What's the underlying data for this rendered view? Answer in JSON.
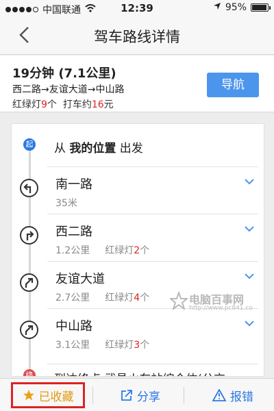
{
  "status": {
    "carrier": "中国联通",
    "time": "12:39",
    "battery": "95%",
    "battery_level": 0.95
  },
  "nav": {
    "title": "驾车路线详情"
  },
  "summary": {
    "duration_distance": "19分钟 (7.1公里)",
    "roads": "西二路→友谊大道→中山路",
    "lights_prefix": "红绿灯",
    "lights_count": "9",
    "lights_suffix": "个  打车约",
    "fare": "16",
    "fare_unit": "元",
    "navigate_label": "导航"
  },
  "route": {
    "start_badge": "起",
    "start_prefix": "从 ",
    "start_place": "我的位置",
    "start_suffix": " 出发",
    "steps": [
      {
        "name": "南一路",
        "distance": "35米",
        "lights_label": "",
        "lights_count": "",
        "lights_unit": "",
        "icon": "turn-left-icon"
      },
      {
        "name": "西二路",
        "distance": "1.2公里",
        "lights_label": "红绿灯",
        "lights_count": "2",
        "lights_unit": "个",
        "icon": "turn-right-icon"
      },
      {
        "name": "友谊大道",
        "distance": "2.7公里",
        "lights_label": "红绿灯",
        "lights_count": "4",
        "lights_unit": "个",
        "icon": "bear-right-icon"
      },
      {
        "name": "中山路",
        "distance": "3.1公里",
        "lights_label": "红绿灯",
        "lights_count": "3",
        "lights_unit": "个",
        "icon": "bear-right-icon"
      }
    ],
    "dest_badge": "终",
    "dest_text": "到达终点 武昌火车站综合体(公交"
  },
  "watermark": {
    "title": "电脑百事网",
    "url": "http://www.pc841.co"
  },
  "toolbar": {
    "favorite_label": "已收藏",
    "share_label": "分享",
    "report_label": "报错"
  }
}
